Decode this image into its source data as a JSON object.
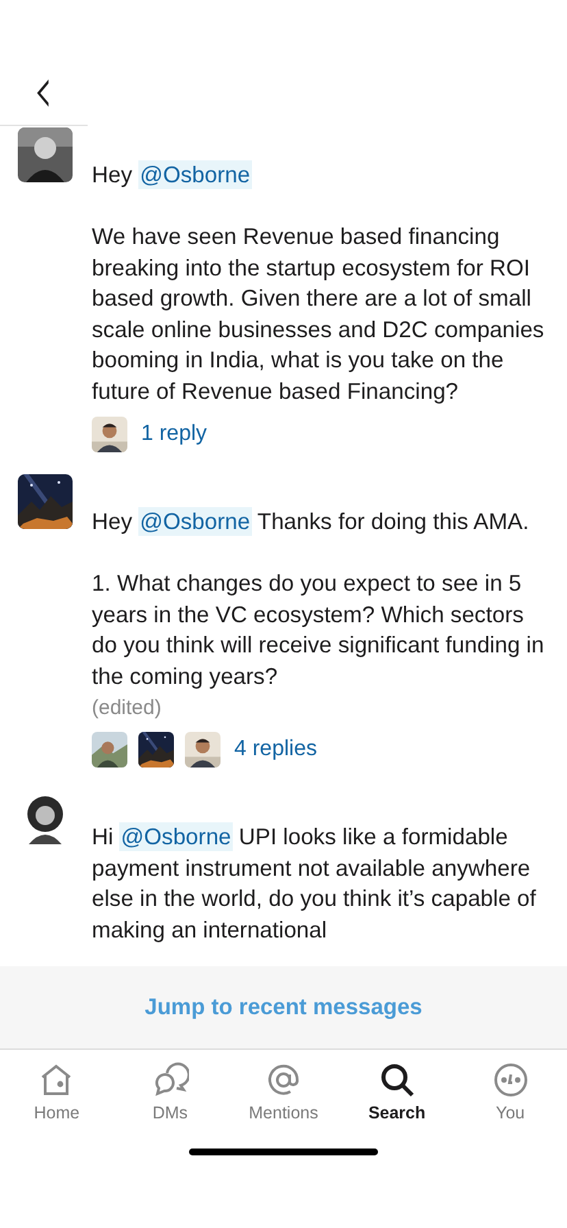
{
  "header": {
    "back_icon": "‹"
  },
  "messages": [
    {
      "avatar": {
        "kind": "person-dark"
      },
      "before": "Hey ",
      "mention": "@Osborne",
      "after": "\n\nWe have seen Revenue based financing breaking into the startup ecosystem for ROI based growth. Given there are a lot of small scale online businesses and D2C companies booming in India, what is you take on the future of Revenue based Financing?",
      "replies": {
        "avatars": [
          {
            "kind": "person-light"
          }
        ],
        "label": "1 reply"
      }
    },
    {
      "avatar": {
        "kind": "night-sky"
      },
      "before": "Hey ",
      "mention": "@Osborne",
      "after": " Thanks for doing this AMA.\n\n1. What changes do you expect to see in 5 years in the VC ecosystem? Which sectors do you think will receive significant funding in the coming years?",
      "edited_label": "(edited)",
      "replies": {
        "avatars": [
          {
            "kind": "person-hills"
          },
          {
            "kind": "night-sky"
          },
          {
            "kind": "person-light"
          }
        ],
        "label": "4 replies"
      }
    },
    {
      "avatar": {
        "kind": "person-curly"
      },
      "before": "Hi ",
      "mention": "@Osborne",
      "after": " UPI looks like a formidable payment instrument not available anywhere else in the world, do you think it’s capable of making an international"
    }
  ],
  "jump_bar": {
    "label": "Jump to recent messages"
  },
  "tabs": [
    {
      "label": "Home",
      "selected": false
    },
    {
      "label": "DMs",
      "selected": false
    },
    {
      "label": "Mentions",
      "selected": false
    },
    {
      "label": "Search",
      "selected": true
    },
    {
      "label": "You",
      "selected": false
    }
  ]
}
